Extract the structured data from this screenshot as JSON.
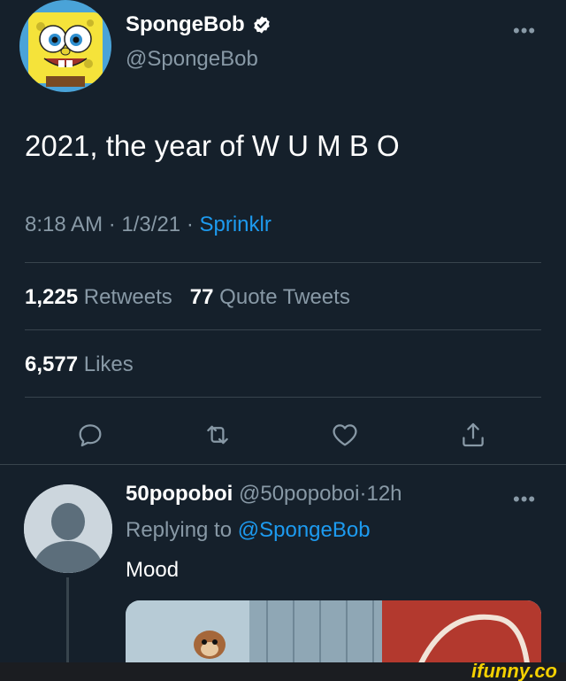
{
  "tweet": {
    "author_name": "SpongeBob",
    "author_handle": "@SpongeBob",
    "more_label": "•••",
    "text": "2021, the year of W U M B O",
    "time": "8:18 AM",
    "date": "1/3/21",
    "separator": "·",
    "source": "Sprinklr",
    "retweets_count": "1,225",
    "retweets_label": "Retweets",
    "quote_count": "77",
    "quote_label": "Quote Tweets",
    "likes_count": "6,577",
    "likes_label": "Likes"
  },
  "actions": [
    {
      "name": "reply-icon"
    },
    {
      "name": "retweet-icon"
    },
    {
      "name": "like-icon"
    },
    {
      "name": "share-icon"
    }
  ],
  "reply": {
    "author_name": "50popoboi",
    "author_handle": "@50popoboi",
    "time": "12h",
    "separator": "·",
    "replying_prefix": "Replying to",
    "replying_mention": "@SpongeBob",
    "text": "Mood",
    "more_label": "•••"
  },
  "watermark": "ifunny.co",
  "colors": {
    "background": "#15202b",
    "text": "#ffffff",
    "secondary": "#8899a6",
    "link": "#1d9bf0",
    "divider": "#38444d",
    "watermark": "#f4d000"
  }
}
